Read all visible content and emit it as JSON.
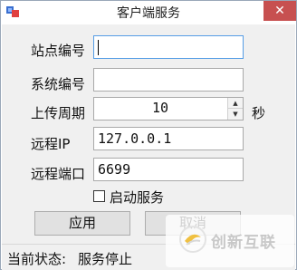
{
  "window": {
    "title": "客户端服务",
    "close_glyph": "✕"
  },
  "form": {
    "station_no_label": "站点编号",
    "station_no_value": "",
    "system_no_label": "系统编号",
    "system_no_value": "",
    "upload_period_label": "上传周期",
    "upload_period_value": "10",
    "upload_period_unit": "秒",
    "remote_ip_label": "远程IP",
    "remote_ip_value": "127.0.0.1",
    "remote_port_label": "远程端口",
    "remote_port_value": "6699",
    "autostart_label": "启动服务",
    "autostart_checked": false
  },
  "buttons": {
    "apply_label": "应用",
    "cancel_label": "取消"
  },
  "status": {
    "label": "当前状态:",
    "value": "服务停止"
  },
  "watermark": {
    "text": "创新互联"
  },
  "icons": {
    "app": "app-window-icon",
    "spin_up": "spin-up-icon",
    "spin_down": "spin-down-icon"
  },
  "colors": {
    "close_button": "#c75050",
    "focus_border": "#569de5",
    "client_bg": "#f0f0f0"
  }
}
